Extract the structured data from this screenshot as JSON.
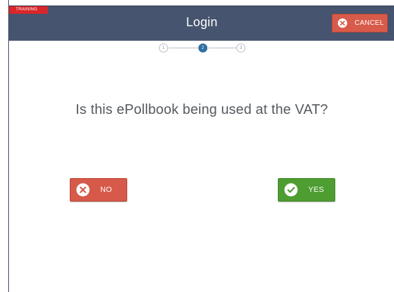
{
  "header": {
    "training_tag": "TRAINING",
    "title": "Login",
    "cancel_label": "CANCEL"
  },
  "stepper": {
    "steps": [
      "1",
      "2",
      "3"
    ],
    "active_step": 2
  },
  "question": "Is this ePollbook being used at the VAT?",
  "buttons": {
    "no_label": "NO",
    "yes_label": "YES"
  },
  "colors": {
    "header_bg": "#46546f",
    "cancel": "#d75a4a",
    "no": "#d6594a",
    "yes": "#4e9d31",
    "active_step": "#2f6fa0",
    "training": "#d9262a"
  },
  "icons": {
    "cancel": "close-circle-icon",
    "no": "close-circle-icon",
    "yes": "check-circle-icon"
  }
}
